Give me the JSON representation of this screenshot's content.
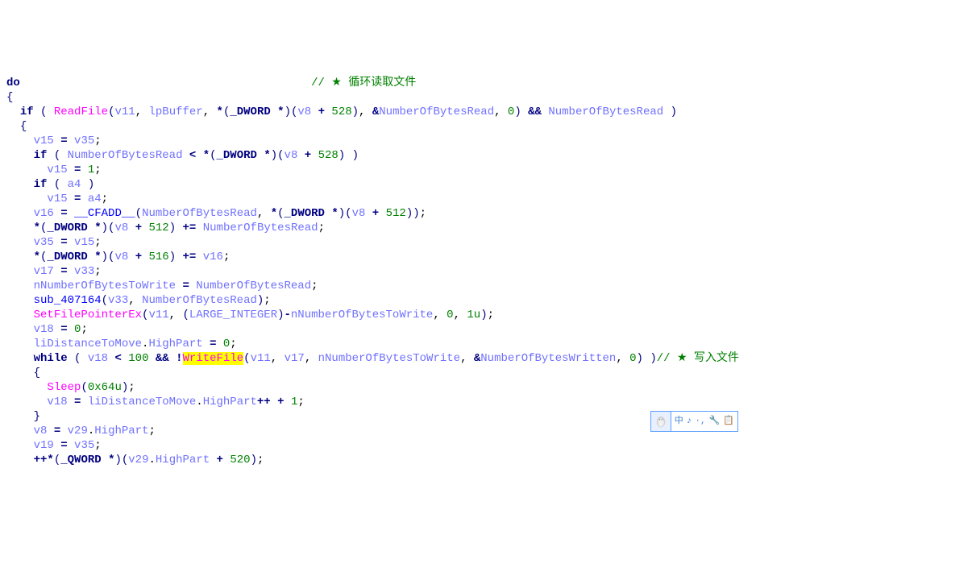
{
  "code": {
    "l1_do": "do",
    "l1_comment": "// ★ 循环读取文件",
    "l2": "{",
    "l3_if": "if",
    "l3_readfile": "ReadFile",
    "l3_v11": "v11",
    "l3_lpbuf": "lpBuffer",
    "l3_dword": "_DWORD",
    "l3_v8": "v8",
    "l3_528": "528",
    "l3_nobr": "NumberOfBytesRead",
    "l3_zero": "0",
    "l3_and": "&&",
    "l3_nobr2": "NumberOfBytesRead",
    "l4": "{",
    "l5_v15": "v15",
    "l5_eq": "=",
    "l5_v35": "v35",
    "l6_if": "if",
    "l6_nobr": "NumberOfBytesRead",
    "l6_lt": "<",
    "l6_dword": "_DWORD",
    "l6_v8": "v8",
    "l6_528": "528",
    "l7_v15": "v15",
    "l7_one": "1",
    "l8_if": "if",
    "l8_a4": "a4",
    "l9_v15": "v15",
    "l9_a4": "a4",
    "l10_v16": "v16",
    "l10_cfadd": "__CFADD__",
    "l10_nobr": "NumberOfBytesRead",
    "l10_dword": "_DWORD",
    "l10_v8": "v8",
    "l10_512": "512",
    "l11_dword": "_DWORD",
    "l11_v8": "v8",
    "l11_512": "512",
    "l11_pluseq": "+=",
    "l11_nobr": "NumberOfBytesRead",
    "l12_v35": "v35",
    "l12_v15": "v15",
    "l13_dword": "_DWORD",
    "l13_v8": "v8",
    "l13_516": "516",
    "l13_v16": "v16",
    "l14_v17": "v17",
    "l14_v33": "v33",
    "l15_nnbtw": "nNumberOfBytesToWrite",
    "l15_nobr": "NumberOfBytesRead",
    "l16_sub": "sub_407164",
    "l16_v33": "v33",
    "l16_nobr": "NumberOfBytesRead",
    "l17_sfpe": "SetFilePointerEx",
    "l17_v11": "v11",
    "l17_li": "LARGE_INTEGER",
    "l17_neg": "-",
    "l17_nnbtw": "nNumberOfBytesToWrite",
    "l17_zero": "0",
    "l17_1u": "1u",
    "l18_v18": "v18",
    "l18_zero": "0",
    "l19_lidtm": "liDistanceToMove",
    "l19_hp": "HighPart",
    "l19_zero": "0",
    "l20_while": "while",
    "l20_v18": "v18",
    "l20_100": "100",
    "l20_and": "&&",
    "l20_not": "!",
    "l20_wf": "WriteFile",
    "l20_v11": "v11",
    "l20_v17": "v17",
    "l20_nnbtw": "nNumberOfBytesToWrite",
    "l20_nobw": "NumberOfBytesWritten",
    "l20_zero": "0",
    "l20_comment": "// ★ 写入文件",
    "l21": "{",
    "l22_sleep": "Sleep",
    "l22_hex": "0x64u",
    "l23_v18": "v18",
    "l23_lidtm": "liDistanceToMove",
    "l23_hp": "HighPart",
    "l23_one": "1",
    "l24": "}",
    "l25_v8": "v8",
    "l25_v29": "v29",
    "l25_hp": "HighPart",
    "l26_v19": "v19",
    "l26_v35": "v35",
    "l27_inc": "++",
    "l27_qword": "_QWORD",
    "l27_v29": "v29",
    "l27_hp": "HighPart",
    "l27_520": "520"
  },
  "toolbar": {
    "item1": "中",
    "item2": "♪",
    "item3": "·,",
    "item4": "🔧",
    "item5": "📋"
  }
}
